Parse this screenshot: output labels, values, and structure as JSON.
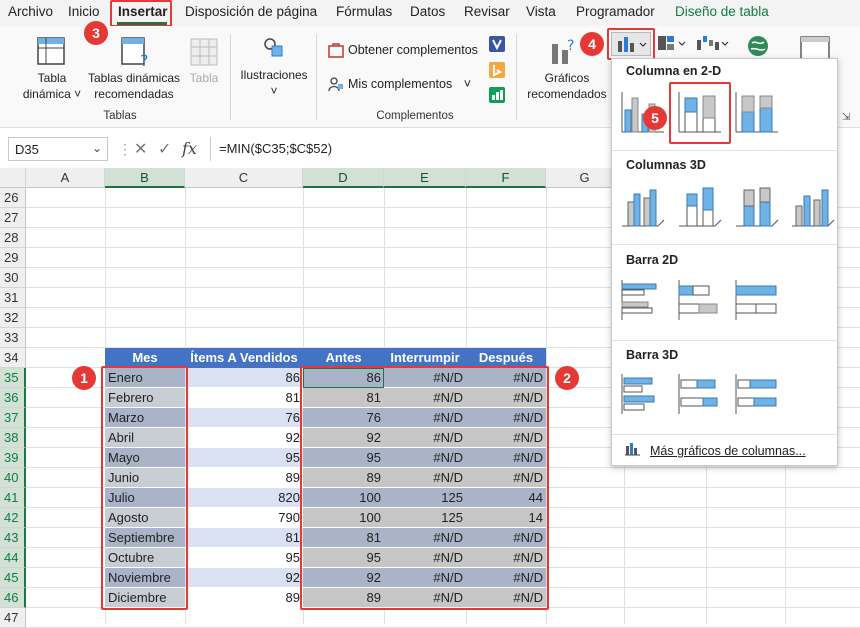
{
  "menu": {
    "tabs": [
      "Archivo",
      "Inicio",
      "Insertar",
      "Disposición de página",
      "Fórmulas",
      "Datos",
      "Revisar",
      "Vista",
      "Programador",
      "Diseño de tabla"
    ]
  },
  "ribbon": {
    "tabla_dinamica": "Tabla",
    "tabla_dinamica2": "dinámica",
    "tablas_recomendadas": "Tablas dinámicas",
    "tablas_recomendadas2": "recomendadas",
    "tabla": "Tabla",
    "group_tablas": "Tablas",
    "ilustraciones": "Ilustraciones",
    "obtener": "Obtener complementos",
    "mis": "Mis complementos",
    "group_complementos": "Complementos",
    "graficos": "Gráficos",
    "graficos2": "recomendados"
  },
  "formula_bar": {
    "name_box": "D35",
    "formula": "=MIN($C35;$C$52)"
  },
  "grid": {
    "columns": [
      "A",
      "B",
      "C",
      "D",
      "E",
      "F",
      "G"
    ],
    "rows": [
      "26",
      "27",
      "28",
      "29",
      "30",
      "31",
      "32",
      "33",
      "34",
      "35",
      "36",
      "37",
      "38",
      "39",
      "40",
      "41",
      "42",
      "43",
      "44",
      "45",
      "46",
      "47"
    ],
    "table_headers": [
      "Mes",
      "Ítems A Vendidos",
      "Antes",
      "Interrumpir",
      "Después"
    ],
    "table_rows": [
      [
        "Enero",
        "86",
        "86",
        "#N/D",
        "#N/D"
      ],
      [
        "Febrero",
        "81",
        "81",
        "#N/D",
        "#N/D"
      ],
      [
        "Marzo",
        "76",
        "76",
        "#N/D",
        "#N/D"
      ],
      [
        "Abril",
        "92",
        "92",
        "#N/D",
        "#N/D"
      ],
      [
        "Mayo",
        "95",
        "95",
        "#N/D",
        "#N/D"
      ],
      [
        "Junio",
        "89",
        "89",
        "#N/D",
        "#N/D"
      ],
      [
        "Julio",
        "820",
        "100",
        "125",
        "44"
      ],
      [
        "Agosto",
        "790",
        "100",
        "125",
        "14"
      ],
      [
        "Septiembre",
        "81",
        "81",
        "#N/D",
        "#N/D"
      ],
      [
        "Octubre",
        "95",
        "95",
        "#N/D",
        "#N/D"
      ],
      [
        "Noviembre",
        "92",
        "92",
        "#N/D",
        "#N/D"
      ],
      [
        "Diciembre",
        "89",
        "89",
        "#N/D",
        "#N/D"
      ]
    ]
  },
  "dropdown": {
    "section1": "Columna en 2-D",
    "section2": "Columnas 3D",
    "section3": "Barra 2D",
    "section4": "Barra 3D",
    "more": "Más gráficos de columnas..."
  },
  "badges": [
    "1",
    "2",
    "3",
    "4",
    "5"
  ],
  "colors": {
    "accent_green": "#217346",
    "table_header": "#4472c4",
    "band": "#d9e1f2",
    "selection": "#c6c6c6",
    "callout_red": "#e53935",
    "chart_blue": "#6fb3e6",
    "chart_gray": "#c8c8c8"
  }
}
